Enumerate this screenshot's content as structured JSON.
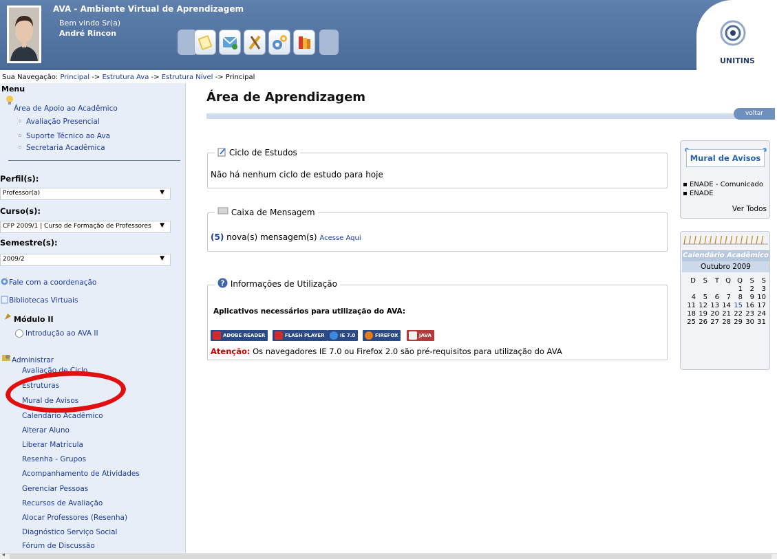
{
  "header": {
    "title": "AVA - Ambiente Virtual de Aprendizagem",
    "welcome": "Bem vindo Sr(a)",
    "user_name": "André Rincon",
    "logo_text": "UNITINS"
  },
  "breadcrumb": {
    "prefix": "Sua Navegação:",
    "items": [
      "Principal",
      "Estrutura Ava",
      "Estrutura Nível"
    ],
    "separator": "->",
    "current": "Principal"
  },
  "sidebar": {
    "menu_title": "Menu",
    "apoio": {
      "label": "Área de Apoio ao Acadêmico",
      "items": [
        "Avaliação Presencial",
        "Suporte Técnico ao Ava",
        "Secretaria Acadêmica"
      ]
    },
    "perfil": {
      "label": "Perfil(s):",
      "value": "Professor(a)"
    },
    "curso": {
      "label": "Curso(s):",
      "value": "CFP 2009/1 | Curso de Formação de Professores"
    },
    "semestre": {
      "label": "Semestre(s):",
      "value": "2009/2"
    },
    "coordenacao": "Fale com a coordenação",
    "bibliotecas": "Bibliotecas Virtuais",
    "modulo": "Módulo II",
    "modulo_item": "Introdução ao AVA II",
    "administrar": {
      "label": "Administrar",
      "items": [
        "Avaliação de Ciclo",
        "Estruturas",
        "Mural de Avisos",
        "Calendário Acadêmico",
        "Alterar Aluno",
        "Liberar Matrícula",
        "Resenha - Grupos",
        "Acompanhamento de Atividades",
        "Gerenciar Pessoas",
        "Recursos de Avaliação",
        "Alocar Professores (Resenha)",
        "Diagnóstico Serviço Social",
        "Fórum de Discussão"
      ]
    }
  },
  "main": {
    "title": "Área de Aprendizagem",
    "back_label": "voltar",
    "ciclo": {
      "legend": "Ciclo de Estudos",
      "text": "Não há nenhum ciclo de estudo para hoje"
    },
    "caixa": {
      "legend": "Caixa de Mensagem",
      "count": "(5)",
      "text": "nova(s) mensagem(s)",
      "link": "Acesse Aqui"
    },
    "info": {
      "legend": "Informações de Utilização",
      "heading": "Aplicativos necessários para utilização do AVA:",
      "apps": [
        {
          "label": "ADOBE READER",
          "color": "#2b4a85",
          "icon_color": "#d62b2b"
        },
        {
          "label": "FLASH PLAYER",
          "color": "#2b4a85",
          "icon_color": "#d62b2b"
        },
        {
          "label": "IE 7.0",
          "color": "#2b4a85",
          "icon_color": "#3a8be0"
        },
        {
          "label": "FIREFOX",
          "color": "#2b4a85",
          "icon_color": "#e07a1a"
        },
        {
          "label": "JAVA",
          "color": "#b23a3a",
          "icon_color": "#f0f0f0"
        }
      ],
      "warning_label": "Atenção:",
      "warning_text": "Os navegadores IE 7.0 ou Firefox 2.0 são pré-requisitos para utilização do AVA"
    }
  },
  "mural": {
    "title": "Mural de Avisos",
    "items": [
      "ENADE - Comunicado",
      "ENADE"
    ],
    "ver_todos": "Ver Todos"
  },
  "calendar": {
    "title": "Calendário Acadêmico",
    "month": "Outubro 2009",
    "weekdays": [
      "D",
      "S",
      "T",
      "Q",
      "Q",
      "S",
      "S"
    ],
    "weeks": [
      [
        "",
        "",
        "",
        "",
        "1",
        "2",
        "3"
      ],
      [
        "4",
        "5",
        "6",
        "7",
        "8",
        "9",
        "10"
      ],
      [
        "11",
        "12",
        "13",
        "14",
        "15",
        "16",
        "17"
      ],
      [
        "18",
        "19",
        "20",
        "21",
        "22",
        "23",
        "24"
      ],
      [
        "25",
        "26",
        "27",
        "28",
        "29",
        "30",
        "31"
      ]
    ],
    "today": "15"
  },
  "colors": {
    "header_bg": "#4a6a98",
    "link": "#1a3a9c",
    "warning": "#cc0000",
    "annotation": "#e01010"
  }
}
